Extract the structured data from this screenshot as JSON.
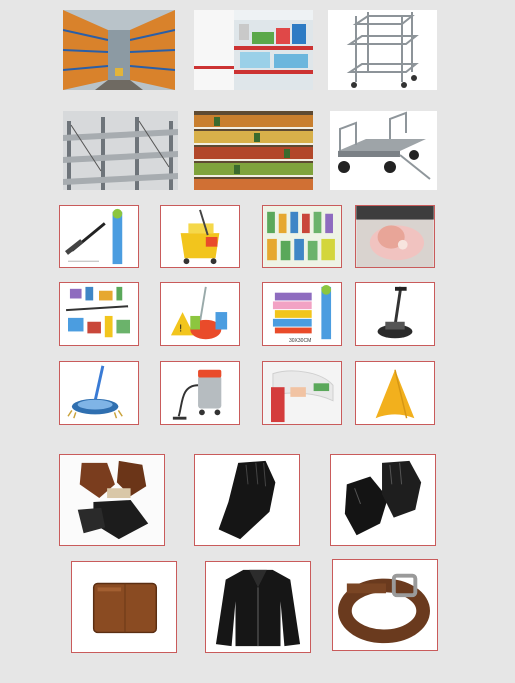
{
  "colors": {
    "page_background": "#e6e6e6",
    "tile_border": "#c95b5b"
  },
  "tiles": [
    {
      "icon": "warehouse-racks-icon"
    },
    {
      "icon": "store-shelf-icon"
    },
    {
      "icon": "shelf-trolley-icon"
    },
    {
      "icon": "steel-shelving-icon"
    },
    {
      "icon": "supermarket-aisle-icon"
    },
    {
      "icon": "platform-cart-icon"
    },
    {
      "icon": "window-squeegee-icon"
    },
    {
      "icon": "mop-bucket-icon"
    },
    {
      "icon": "cleaning-tools-chart-icon"
    },
    {
      "icon": "dishwashing-glove-icon"
    },
    {
      "icon": "cleaning-supplies-set-icon"
    },
    {
      "icon": "housekeeping-kit-icon"
    },
    {
      "icon": "microfiber-cloths-icon",
      "size_label": "30X30CM"
    },
    {
      "icon": "floor-polisher-icon"
    },
    {
      "icon": "hand-push-sweeper-icon"
    },
    {
      "icon": "wet-dry-vacuum-icon"
    },
    {
      "icon": "cleaning-cloth-hand-icon"
    },
    {
      "icon": "yellow-duster-icon"
    },
    {
      "icon": "leather-gloves-collection-icon"
    },
    {
      "icon": "black-leather-glove-icon"
    },
    {
      "icon": "tactical-gloves-icon"
    },
    {
      "icon": "leather-wallet-icon"
    },
    {
      "icon": "leather-jacket-icon"
    },
    {
      "icon": "leather-belt-icon"
    }
  ]
}
